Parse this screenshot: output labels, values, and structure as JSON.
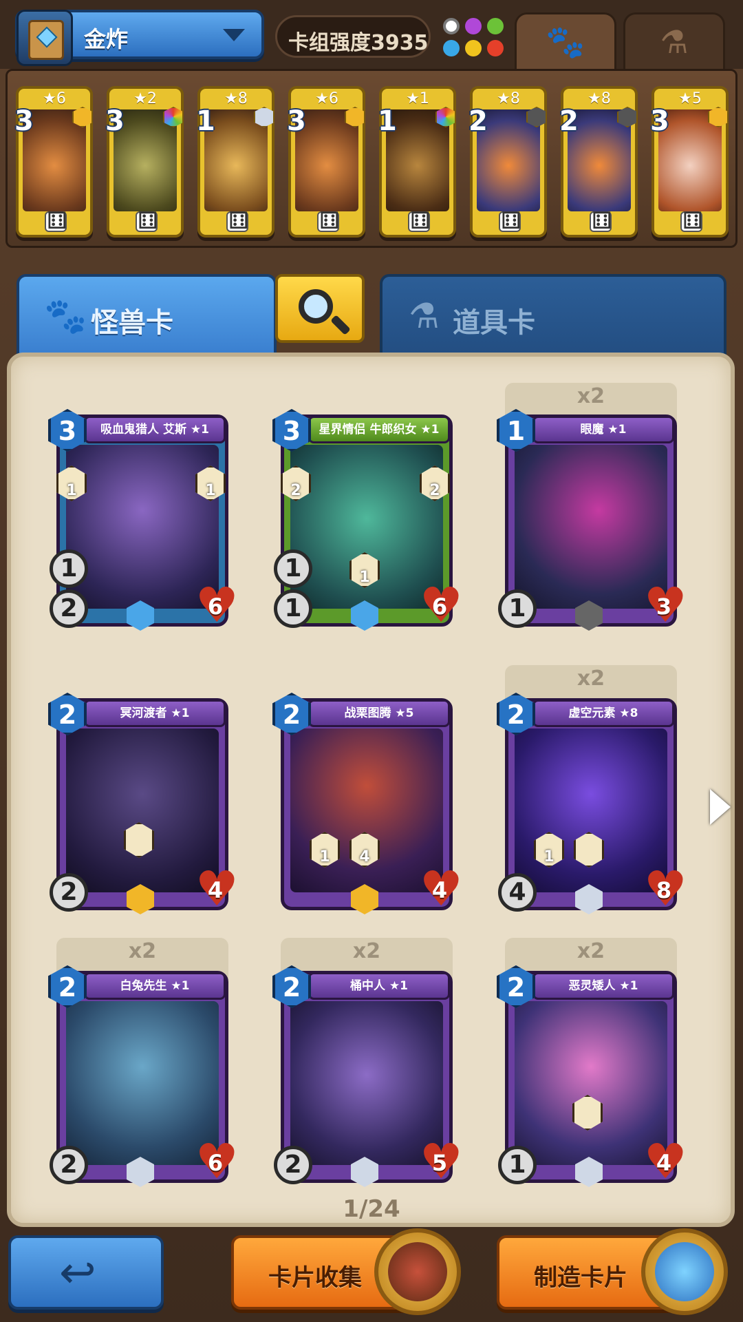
{
  "header": {
    "deck_name": "金炸",
    "deck_power_label": "卡组强度3935",
    "tab_monster_icon": "paw-icon",
    "tab_item_icon": "flask-icon"
  },
  "deck": [
    {
      "stars": "★6",
      "count": "3"
    },
    {
      "stars": "★2",
      "count": "3"
    },
    {
      "stars": "★8",
      "count": "1"
    },
    {
      "stars": "★6",
      "count": "3"
    },
    {
      "stars": "★1",
      "count": "1"
    },
    {
      "stars": "★8",
      "count": "2"
    },
    {
      "stars": "★8",
      "count": "2"
    },
    {
      "stars": "★5",
      "count": "3"
    }
  ],
  "tabs": {
    "monster_label": "怪兽卡",
    "item_label": "道具卡"
  },
  "cards": [
    {
      "name": "吸血鬼猎人 艾斯 ★1",
      "cost": "3",
      "attack": "2",
      "range": "1",
      "hp": "6",
      "ability1": "1",
      "ability2": "1",
      "dup": ""
    },
    {
      "name": "星界情侣 牛郎织女 ★1",
      "cost": "3",
      "attack": "1",
      "range": "1",
      "hp": "6",
      "ability1": "2",
      "ability2": "2",
      "ability3": "1",
      "dup": ""
    },
    {
      "name": "眼魔 ★1",
      "cost": "1",
      "attack": "1",
      "range": "",
      "hp": "3",
      "dup": "x2"
    },
    {
      "name": "冥河渡者 ★1",
      "cost": "2",
      "attack": "2",
      "range": "",
      "hp": "4",
      "dup": ""
    },
    {
      "name": "战栗图腾 ★5",
      "cost": "2",
      "attack": "",
      "range": "",
      "hp": "4",
      "ability1": "1",
      "ability2": "4",
      "dup": ""
    },
    {
      "name": "虚空元素 ★8",
      "cost": "2",
      "attack": "4",
      "range": "",
      "hp": "8",
      "ability1": "1",
      "dup": "x2"
    },
    {
      "name": "白兔先生 ★1",
      "cost": "2",
      "attack": "2",
      "range": "",
      "hp": "6",
      "dup": "x2"
    },
    {
      "name": "桶中人 ★1",
      "cost": "2",
      "attack": "2",
      "range": "",
      "hp": "5",
      "dup": "x2"
    },
    {
      "name": "恶灵矮人 ★1",
      "cost": "2",
      "attack": "1",
      "range": "",
      "hp": "4",
      "dup": "x2"
    }
  ],
  "pagination": {
    "label": "1/24"
  },
  "bottom": {
    "back_icon": "back-arrow-icon",
    "collection_label": "卡片收集",
    "craft_label": "制造卡片"
  }
}
